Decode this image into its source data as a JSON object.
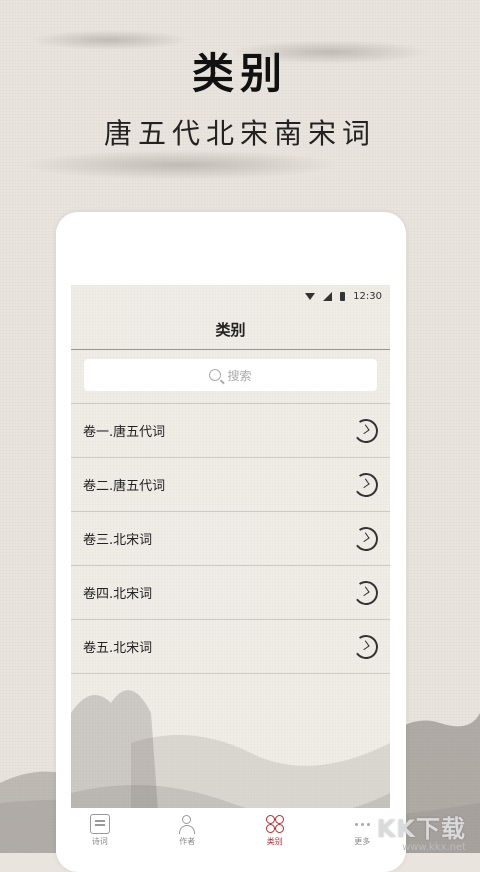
{
  "hero": {
    "title": "类别",
    "subtitle": "唐五代北宋南宋词"
  },
  "status_bar": {
    "time": "12:30"
  },
  "screen": {
    "nav_title": "类别",
    "search_placeholder": "搜索",
    "items": [
      {
        "label": "卷一.唐五代词"
      },
      {
        "label": "卷二.唐五代词"
      },
      {
        "label": "卷三.北宋词"
      },
      {
        "label": "卷四.北宋词"
      },
      {
        "label": "卷五.北宋词"
      }
    ]
  },
  "tabbar": {
    "tabs": [
      {
        "label": "诗词",
        "icon": "poem-icon",
        "active": false
      },
      {
        "label": "作者",
        "icon": "author-icon",
        "active": false
      },
      {
        "label": "类别",
        "icon": "category-icon",
        "active": true
      },
      {
        "label": "更多",
        "icon": "more-icon",
        "active": false
      }
    ]
  },
  "watermark": {
    "main": "KK下载",
    "sub": "www.kkx.net"
  },
  "colors": {
    "accent": "#c2272d",
    "background": "#e9e4dd",
    "screen_background": "#f0ece6"
  }
}
